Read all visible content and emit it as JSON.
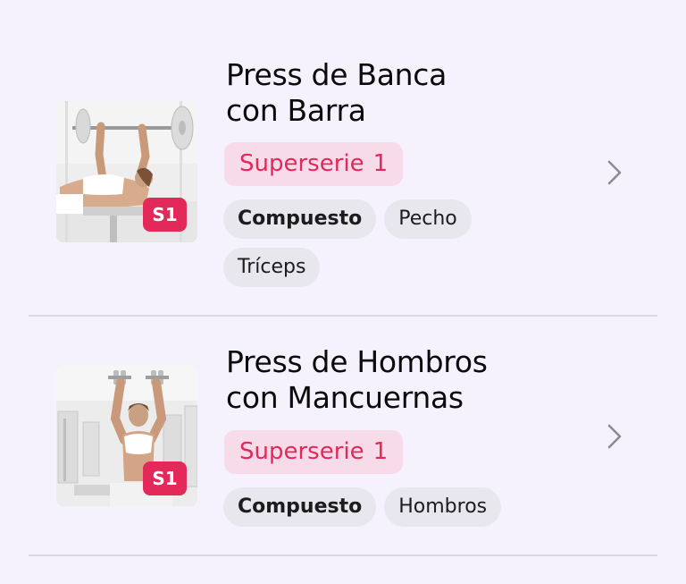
{
  "colors": {
    "background": "#f6f2fd",
    "accent": "#e3285a",
    "superset_bg": "#f8dbe8",
    "tag_bg": "#e9e7ee",
    "chevron": "#8d8b93",
    "divider": "#dcd8e2"
  },
  "exercises": [
    {
      "title_line1": "Press de Banca",
      "title_line2": "con Barra",
      "image_icon": "bench-press-photo",
      "badge": "S1",
      "superset_label": "Superserie",
      "superset_number": "1",
      "tags": [
        {
          "label": "Compuesto",
          "bold": true
        },
        {
          "label": "Pecho",
          "bold": false
        },
        {
          "label": "Tríceps",
          "bold": false
        }
      ],
      "chevron_icon": "chevron-right-icon"
    },
    {
      "title_line1": "Press de Hombros",
      "title_line2": "con Mancuernas",
      "image_icon": "dumbbell-shoulder-press-photo",
      "badge": "S1",
      "superset_label": "Superserie",
      "superset_number": "1",
      "tags": [
        {
          "label": "Compuesto",
          "bold": true
        },
        {
          "label": "Hombros",
          "bold": false
        }
      ],
      "chevron_icon": "chevron-right-icon"
    }
  ]
}
